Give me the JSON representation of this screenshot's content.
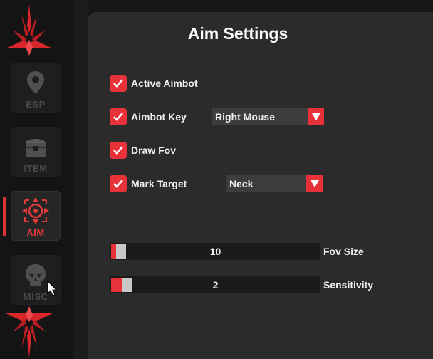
{
  "colors": {
    "accent": "#e8323a",
    "panel": "#2b2b2b",
    "sidebar": "#141414"
  },
  "sidebar": {
    "items": [
      {
        "label": "ESP",
        "icon": "map-pin-icon",
        "active": false
      },
      {
        "label": "ITEM",
        "icon": "treasure-chest-icon",
        "active": false
      },
      {
        "label": "AIM",
        "icon": "crosshair-icon",
        "active": true
      },
      {
        "label": "MISC",
        "icon": "skull-icon",
        "active": false
      }
    ]
  },
  "panel": {
    "title": "Aim Settings",
    "options": [
      {
        "label": "Active Aimbot",
        "checked": true
      },
      {
        "label": "Aimbot Key",
        "checked": true
      },
      {
        "label": "Draw Fov",
        "checked": true
      },
      {
        "label": "Mark Target",
        "checked": true
      }
    ],
    "aimbot_key_value": "Right Mouse",
    "mark_target_value": "Neck",
    "sliders": [
      {
        "label": "Fov Size",
        "value": "10"
      },
      {
        "label": "Sensitivity",
        "value": "2"
      }
    ]
  }
}
